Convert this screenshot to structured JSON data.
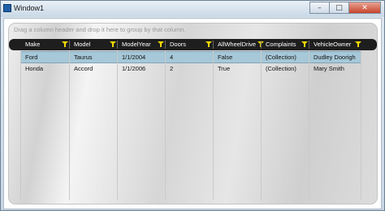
{
  "window": {
    "title": "Window1",
    "controls": {
      "minimize": "–",
      "maximize": "□",
      "close": "✕"
    }
  },
  "grid": {
    "group_panel_text": "Drag a column header and drop it here to group by that column.",
    "columns": [
      "Make",
      "Model",
      "ModelYear",
      "Doors",
      "AllWheelDrive",
      "Complaints",
      "VehicleOwner"
    ],
    "rows": [
      {
        "selected": true,
        "cells": [
          "Ford",
          "Taurus",
          "1/1/2004",
          "4",
          "False",
          "(Collection)",
          "Dudley Doorigh"
        ]
      },
      {
        "selected": false,
        "cells": [
          "Honda",
          "Accord",
          "1/1/2006",
          "2",
          "True",
          "(Collection)",
          "Mary Smith"
        ]
      }
    ]
  },
  "colors": {
    "header_bg": "#1e1e1e",
    "filter_icon": "#f0d800",
    "selected_row": "#a6c8d8"
  }
}
